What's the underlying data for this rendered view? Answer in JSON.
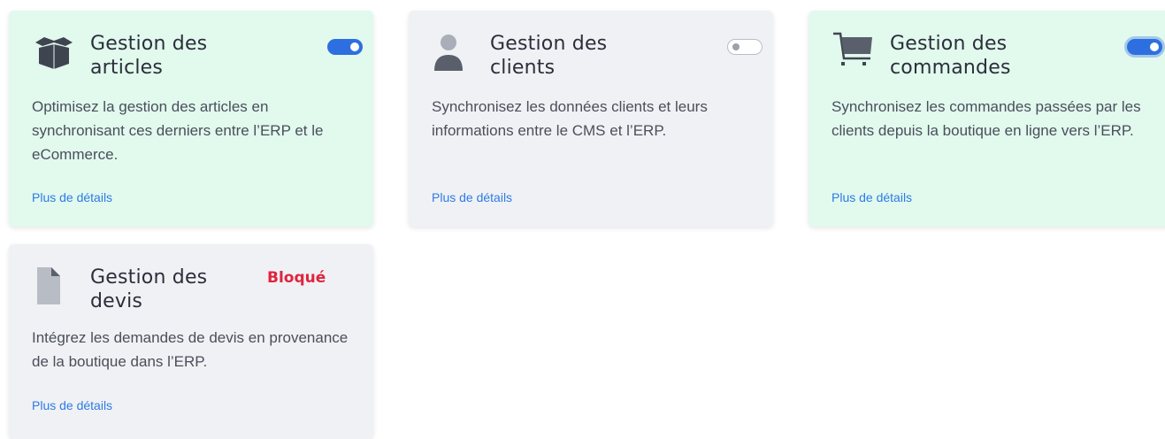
{
  "colors": {
    "active_bg": "#e2f9ee",
    "inactive_bg": "#f0f1f4",
    "toggle_on": "#2d6fe0",
    "link": "#2d7be5",
    "blocked": "#e0243f",
    "icon": "#5a606b"
  },
  "modules": [
    {
      "icon": "box-icon",
      "title": "Gestion des articles",
      "description": "Optimisez la gestion des articles en synchronisant ces derniers entre l’ERP et le eCommerce.",
      "link": "Plus de détails",
      "enabled": true
    },
    {
      "icon": "user-icon",
      "title": "Gestion des clients",
      "description": "Synchronisez les données clients et leurs informations entre le CMS et l’ERP.",
      "link": "Plus de détails",
      "enabled": false
    },
    {
      "icon": "cart-icon",
      "title": "Gestion des commandes",
      "description": "Synchronisez les commandes passées par les clients depuis la boutique en ligne vers l’ERP.",
      "link": "Plus de détails",
      "enabled": true
    },
    {
      "icon": "document-icon",
      "title": "Gestion des devis",
      "description": "Intégrez les demandes de devis en provenance de la boutique dans l’ERP.",
      "link": "Plus de détails",
      "status": "Bloqué"
    }
  ]
}
